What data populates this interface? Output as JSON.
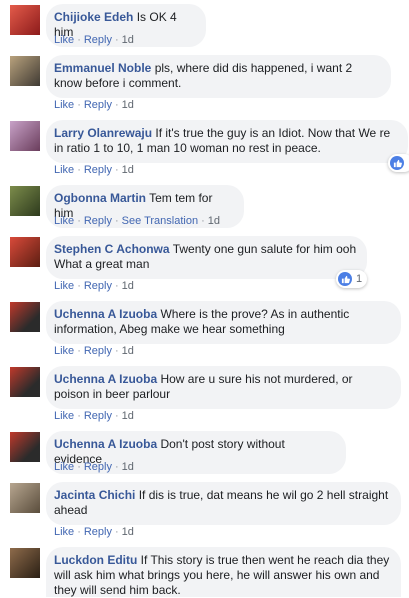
{
  "comments": [
    {
      "author": "Chijioke Edeh",
      "text": "Is OK 4 him",
      "like": "Like",
      "reply": "Reply",
      "time": "1d",
      "avatar_colors": [
        "#e45b4a",
        "#8c1b1b"
      ]
    },
    {
      "author": "Emmanuel Noble",
      "text": "pls, where did dis happened, i want 2 know before i comment.",
      "like": "Like",
      "reply": "Reply",
      "time": "1d",
      "avatar_colors": [
        "#b9a27d",
        "#3f3a33"
      ]
    },
    {
      "author": "Larry Olanrewaju",
      "text": "If it's true the guy is an Idiot. Now that We re in ratio 1 to 10, 1 man 10 woman no rest in peace.",
      "like": "Like",
      "reply": "Reply",
      "time": "1d",
      "avatar_colors": [
        "#c8a2c8",
        "#6a3d5c"
      ],
      "reactions": "1"
    },
    {
      "author": "Ogbonna Martin",
      "text": "Tem tem for him",
      "like": "Like",
      "reply": "Reply",
      "translation": "See Translation",
      "time": "1d",
      "avatar_colors": [
        "#7c8c4b",
        "#2d3a1d"
      ]
    },
    {
      "author": "Stephen C Achonwa",
      "text": "Twenty one gun salute for him ooh What a great man",
      "like": "Like",
      "reply": "Reply",
      "time": "1d",
      "avatar_colors": [
        "#d94a3a",
        "#5c1e12"
      ],
      "reactions": "1"
    },
    {
      "author": "Uchenna A Izuoba",
      "text": "Where is the prove? As in authentic information, Abeg make we hear something",
      "like": "Like",
      "reply": "Reply",
      "time": "1d",
      "avatar_colors": [
        "#c0392b",
        "#2b2b2b"
      ]
    },
    {
      "author": "Uchenna A Izuoba",
      "text": "How are u sure his not murdered, or poison in beer parlour",
      "like": "Like",
      "reply": "Reply",
      "time": "1d",
      "avatar_colors": [
        "#c0392b",
        "#2b2b2b"
      ]
    },
    {
      "author": "Uchenna A Izuoba",
      "text": "Don't post story without evidence",
      "like": "Like",
      "reply": "Reply",
      "time": "1d",
      "avatar_colors": [
        "#c0392b",
        "#2b2b2b"
      ]
    },
    {
      "author": "Jacinta Chichi",
      "text": "If dis is true, dat means he wil go 2 hell straight ahead",
      "like": "Like",
      "reply": "Reply",
      "time": "1d",
      "avatar_colors": [
        "#b7a690",
        "#5a4d3c"
      ]
    },
    {
      "author": "Luckdon Editu",
      "text": "If This story is true then went he reach dia they will ask him what brings you here, he will answer his own and they will send him back.",
      "avatar_colors": [
        "#8e6b4b",
        "#2a1f14"
      ]
    }
  ],
  "colors": {
    "author": "#385898",
    "link": "#4267b2",
    "bubble": "#f2f3f5",
    "like_badge": "#4c7fe5"
  }
}
